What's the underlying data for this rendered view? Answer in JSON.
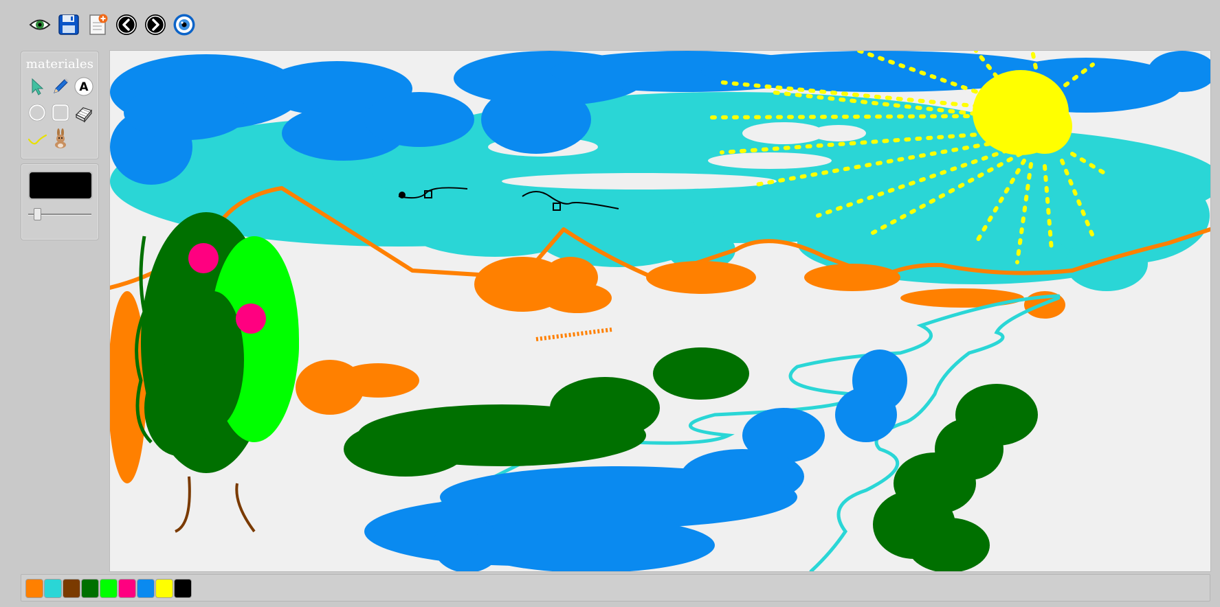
{
  "toolbar": {
    "buttons": [
      {
        "name": "view-eye-icon"
      },
      {
        "name": "save-icon"
      },
      {
        "name": "new-document-icon"
      },
      {
        "name": "previous-icon"
      },
      {
        "name": "next-icon"
      },
      {
        "name": "preview-eye-icon"
      }
    ]
  },
  "tools_panel": {
    "title": "materiales",
    "tools": [
      "select-icon",
      "pencil-icon",
      "text-icon",
      "circle-icon",
      "rectangle-icon",
      "eraser-icon",
      "line-icon",
      "stamp-rabbit-icon"
    ],
    "text_tool_label": "A"
  },
  "color_panel": {
    "current_color": "#000000",
    "brush_size_fraction": 0.1
  },
  "palette": {
    "colors": [
      "#ff8000",
      "#2ad6d6",
      "#7a3a00",
      "#007000",
      "#00ff00",
      "#ff0080",
      "#0a8af0",
      "#ffff00",
      "#000000"
    ]
  },
  "canvas": {
    "background": "#f0f0f0",
    "colors": {
      "sky_blue": "#0a8af0",
      "cyan": "#2ad6d6",
      "sun_yellow": "#ffff00",
      "orange": "#ff8000",
      "dark_green": "#007000",
      "bright_green": "#00ff00",
      "pink": "#ff0080",
      "brown": "#7a3a00",
      "black": "#000000"
    }
  }
}
